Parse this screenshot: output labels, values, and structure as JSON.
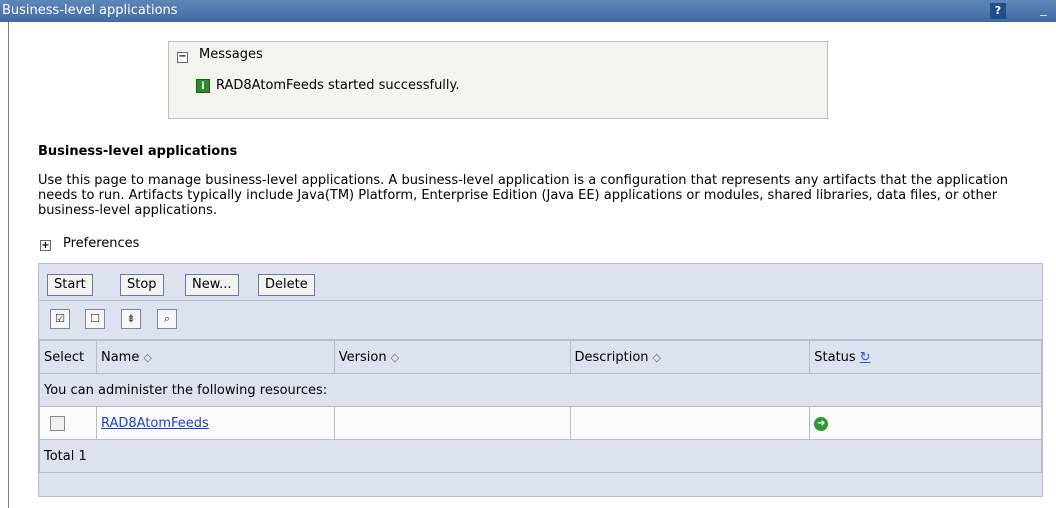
{
  "window": {
    "title": "Business-level applications",
    "help_label": "?",
    "minimize_label": "_"
  },
  "messages": {
    "toggle": "−",
    "title": "Messages",
    "icon": "info-icon",
    "text": "RAD8AtomFeeds started successfully."
  },
  "page": {
    "section_title": "Business-level applications",
    "description": "Use this page to manage business-level applications. A business-level application is a configuration that represents any artifacts that the application needs to run. Artifacts typically include Java(TM) Platform, Enterprise Edition (Java EE) applications or modules, shared libraries, data files, or other business-level applications.",
    "preferences_toggle": "+",
    "preferences_label": "Preferences"
  },
  "toolbar": {
    "start_label": "Start",
    "stop_label": "Stop",
    "new_label": "New...",
    "delete_label": "Delete"
  },
  "icons": [
    "select-all-icon",
    "deselect-all-icon",
    "show-filter-icon",
    "clear-filter-icon"
  ],
  "table": {
    "columns": [
      "Select",
      "Name",
      "Version",
      "Description",
      "Status"
    ],
    "caption": "You can administer the following resources:",
    "rows": [
      {
        "name": "RAD8AtomFeeds",
        "version": "",
        "description": "",
        "status": "started"
      }
    ],
    "total": "Total 1"
  },
  "colors": {
    "title_bar": "#4a73ab",
    "panel": "#dde3ee",
    "link": "#1a44c4",
    "status_green": "#2e9a35"
  }
}
